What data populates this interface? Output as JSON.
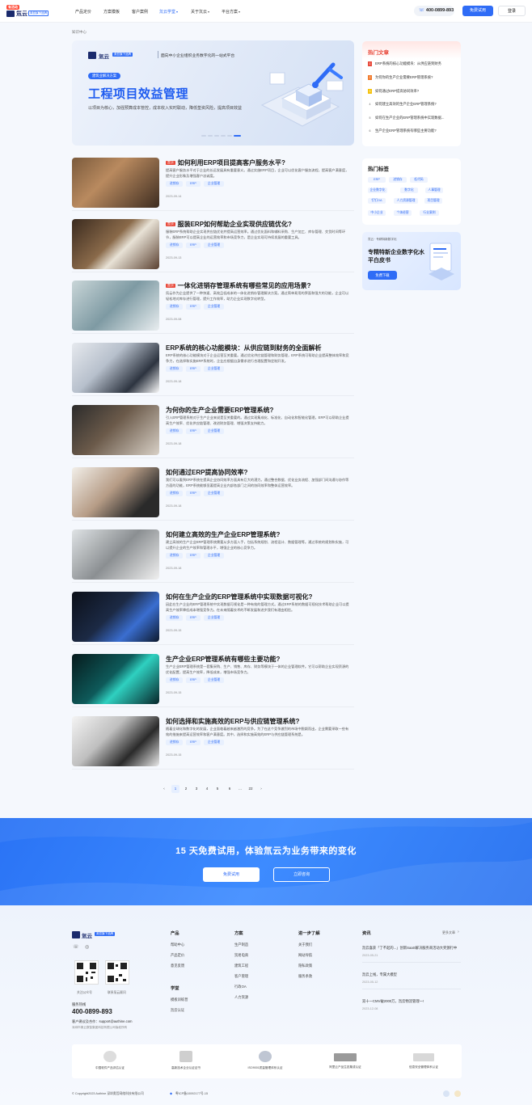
{
  "header": {
    "badge": "有活动",
    "brand": "氚云",
    "brand_tag": "奥哲旗下品牌",
    "nav": [
      "产品定价",
      "方案模板",
      "客户案例",
      "氚云学堂",
      "关于氚云",
      "平台方案"
    ],
    "phone": "400-0899-893",
    "try": "免费试用",
    "login": "登录"
  },
  "breadcrumb": "知识中心",
  "banner": {
    "brand": "氚云",
    "brand_tag": "奥哲旗下品牌",
    "slogan": "面向中小企业组织业务数字化的一站式平台",
    "pill": "建筑业解决方案",
    "title": "工程项目效益管理",
    "desc": "以项目为核心，加强预算成本管控，成本收入实时联动，降低垫资风险，提高项目效益"
  },
  "articles": [
    {
      "hot": "置顶",
      "title": "如何利用ERP项目提高客户服务水平?",
      "desc": "提高客户服务水平对于企业的长远发展具有重要意义。通过实施ERP项目，企业可以优化客户服务流程，提高客户满意度，提升企业形象及增强客户忠诚度。",
      "tags": [
        "进销存",
        "ERP",
        "企业管理"
      ],
      "date": "2023-09-14"
    },
    {
      "hot": "置顶",
      "title": "服装ERP如何帮助企业实现供应链优化?",
      "desc": "服装ERP系统帮助企业实现供应链优化并提高运营效率。通过优化面料和辅料采购、生产加工、库存管理、交货时间等环节，服装ERP可以提高企业的运营效率和市场竞争力，是企业实现可持续发展的重要工具。",
      "tags": [
        "进销存",
        "ERP",
        "企业管理"
      ],
      "date": "2023-09-13"
    },
    {
      "hot": "置顶",
      "title": "一体化进销存管理系统有哪些常见的应用场景?",
      "desc": "氚云作为企业提供了一种快速、高效且低成本的一体化进销存管理解决方案。通过简单易用的界面和强大的功能，企业可以轻松地对库存进行管理，提升工作效率，助力企业实现数字化转型。",
      "tags": [
        "进销存",
        "ERP",
        "企业管理"
      ],
      "date": "2023-09-08"
    },
    {
      "hot": "",
      "title": "ERP系统的核心功能模块：从供应链到财务的全面解析",
      "desc": "ERP系统的核心功能模块对于企业运营至关重要。通过优化供应链管理和财务管理，ERP系统可帮助企业提高整体效率和竞争力，在选择和实施ERP系统时，企业应根据自身需求进行合理配置和定制开发。",
      "tags": [
        "进销存",
        "ERP",
        "企业管理"
      ],
      "date": "2023-09-18"
    },
    {
      "hot": "",
      "title": "为何你的生产企业需要ERP管理系统?",
      "desc": "引入ERP管理系统对于生产企业来说是至关重要的。通过实现集成化、标准化、自动化和智能化管理，ERP可以帮助企业提高生产效率、优化供应链管理、改进财务管理、增强决策支持能力。",
      "tags": [
        "进销存",
        "ERP",
        "企业管理"
      ],
      "date": "2023-09-18"
    },
    {
      "hot": "",
      "title": "如何通过ERP提高协同效率?",
      "desc": "我们可以看到ERP系统在提高企业协同效率方面具有巨大的潜力。通过整合数据、优化业务流程、加强部门间沟通与协作等方面的功能，ERP系统能够显著提高企业内部各部门之间的协同效率和整体运营效率。",
      "tags": [
        "进销存",
        "ERP",
        "企业管理"
      ],
      "date": "2023-09-18"
    },
    {
      "hot": "",
      "title": "如何建立高效的生产企业ERP管理系统?",
      "desc": "建立高效的生产企业ERP管理系统需要从多方面入手，包括系统规划、流程设计、数据管理等。通过系统的规划和实施，可以提升企业的生产效率和管理水平，增强企业的核心竞争力。",
      "tags": [
        "进销存",
        "ERP",
        "企业管理"
      ],
      "date": "2023-09-18"
    },
    {
      "hot": "",
      "title": "如何在生产企业的ERP管理系统中实现数据可视化?",
      "desc": "因此在生产企业的ERP管理系统中实现数据可视化是一种有效的管理方式。通过ERP系统的数据可视化技术帮助企业可以提高生产效率降低成本增强竞争力。在未来随着技术的不断发展和进步我们有理由相信。",
      "tags": [
        "进销存",
        "ERP",
        "企业管理"
      ],
      "date": "2023-09-15"
    },
    {
      "hot": "",
      "title": "生产企业ERP管理系统有哪些主要功能?",
      "desc": "生产企业ERP管理系统是一套集采购、生产、销售、库存、财务等模块于一体的企业管理软件。它可以帮助企业实现资源的优化配置，提高生产效率，降低成本，增强市场竞争力。",
      "tags": [
        "进销存",
        "ERP",
        "企业管理"
      ],
      "date": "2023-09-15"
    },
    {
      "hot": "",
      "title": "如何选择和实施高效的ERP与供应链管理系统?",
      "desc": "随着全球化和数字化的发展，企业面临着越来越激烈的竞争。为了在这个竞争激烈的市场中脱颖而出，企业需要采取一些有效的措施来提高运营效率和客户满意度。其中，选择和实施高效的ERP与供应链管理系统是。",
      "tags": [
        "进销存",
        "ERP",
        "企业管理"
      ],
      "date": "2023-09-15"
    }
  ],
  "pagination": [
    "‹",
    "1",
    "2",
    "3",
    "4",
    "5",
    "6",
    "…",
    "22",
    "›"
  ],
  "hot": {
    "title": "热门文章",
    "items": [
      "ERP系统的核心功能模块：从供应链到财务",
      "为何你的生产企业需要ERP管理系统?",
      "如何通过ERP提高协同效率?",
      "如何建立高效的生产企业ERP管理系统?",
      "如何在生产企业的ERP管理系统中实现数据...",
      "生产企业ERP管理系统有哪些主要功能?"
    ]
  },
  "tags": {
    "title": "热门标签",
    "items": [
      "ERP",
      "进销存",
      "低代码",
      "企业数字化",
      "数字化",
      "人事管理",
      "钉钉OA",
      "人力资源管理",
      "项目管理",
      "中小企业",
      "个体经营",
      "行业案例"
    ]
  },
  "whitepaper": {
    "tag": "氚云 · 专精特新数字化",
    "title": "专精特新企业数字化水平白皮书",
    "button": "免费下载"
  },
  "cta": {
    "title": "15 天免费试用，体验氚云为业务带来的变化",
    "try": "免费试用",
    "contact": "立即咨询"
  },
  "footer": {
    "qr1": "关注公众号",
    "qr2": "联系氚云顾问",
    "hotline_label": "服务热线",
    "hotline": "400-0899-893",
    "email": "客户建议及合作：support@authine.com",
    "email_note": "深圳市奥云数智集团科技有限公司版权所有",
    "cols": [
      {
        "title": "产品",
        "items": [
          "帮助中心",
          "产品定价",
          "意见反馈"
        ]
      },
      {
        "title": "学堂",
        "items": [
          "模板训练营",
          "氚云认证"
        ]
      },
      {
        "title": "方案",
        "items": [
          "生产制造",
          "贸易电商",
          "建筑工程",
          "客户管理",
          "行政OA",
          "人力资源"
        ]
      },
      {
        "title": "进一步了解",
        "items": [
          "关于我们",
          "网站导航",
          "隐私政策",
          "服务条款"
        ]
      }
    ],
    "news_title": "资讯",
    "news_more": "更多文章",
    "news": [
      {
        "t": "氚云喜获「了不起的...」创新SaaS解决服务商活动大奖颁行中",
        "d": "2023-05-21"
      },
      {
        "t": "氚云上线，专属大模型",
        "d": "2023-05-12"
      },
      {
        "t": "双十一CMV破2000万，氚云物流管理一!",
        "d": "2023-12-08"
      }
    ],
    "certs": [
      "中国软件产品评估认证",
      "高新技术企业认证证书",
      "ISO9001质量管理体系认证",
      "阿里云产品生态集成认证",
      "信息安全管理体系认证"
    ],
    "copyright": "© Copyright2023 Authine 深圳奥哲网络科技有限公司",
    "icp": "粤ICP备10092177号-15"
  }
}
